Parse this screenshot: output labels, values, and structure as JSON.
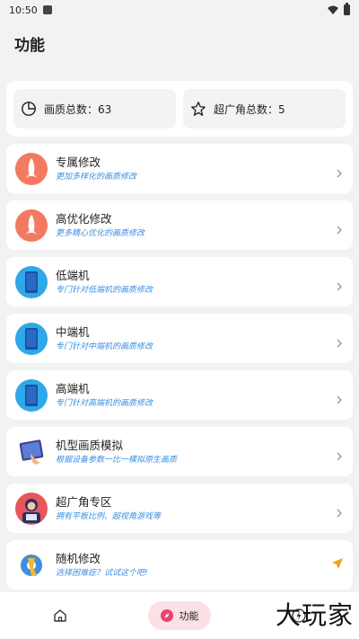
{
  "status": {
    "time": "10:50"
  },
  "page": {
    "title": "功能"
  },
  "stats": [
    {
      "label": "画质总数：63"
    },
    {
      "label": "超广角总数：5"
    }
  ],
  "items": [
    {
      "title": "专属修改",
      "subtitle": "更加多样化的画质修改",
      "icon": "rocket-icon"
    },
    {
      "title": "高优化修改",
      "subtitle": "更多精心优化的画质修改",
      "icon": "rocket-icon"
    },
    {
      "title": "低端机",
      "subtitle": "专门针对低端机的画质修改",
      "icon": "phone-icon"
    },
    {
      "title": "中端机",
      "subtitle": "专门针对中端机的画质修改",
      "icon": "phone-icon"
    },
    {
      "title": "高端机",
      "subtitle": "专门针对高端机的画质修改",
      "icon": "phone-icon"
    },
    {
      "title": "机型画质模拟",
      "subtitle": "根据设备参数一比一模拟原生画质",
      "icon": "tablet-icon"
    },
    {
      "title": "超广角专区",
      "subtitle": "拥有平板比例、超视角游戏等",
      "icon": "gamer-icon"
    },
    {
      "title": "随机修改",
      "subtitle": "选择困难症？试试这个吧!",
      "icon": "wrench-gear-icon"
    }
  ],
  "nav": {
    "active_label": "功能"
  },
  "watermark": "大玩家",
  "colors": {
    "accent": "#3b8fe0",
    "active_nav_bg": "#fbe1e6",
    "send_arrow": "#f0a21a"
  }
}
